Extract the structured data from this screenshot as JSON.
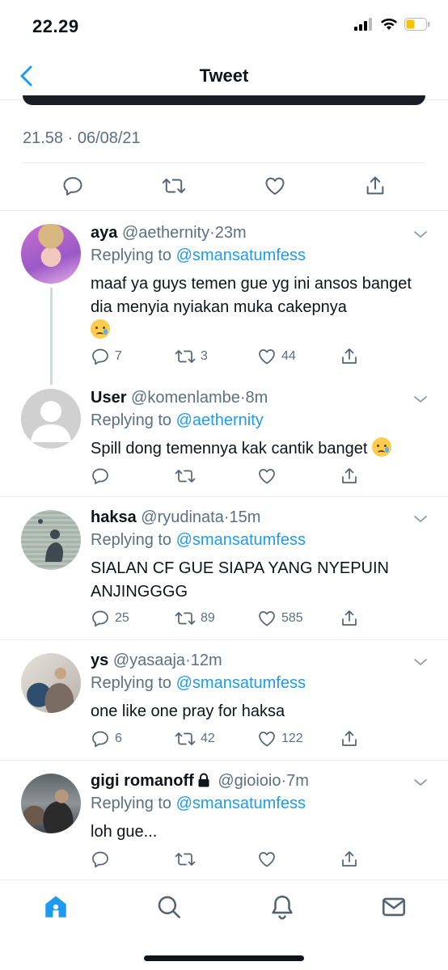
{
  "status_bar": {
    "time": "22.29"
  },
  "nav": {
    "title": "Tweet"
  },
  "tweet": {
    "timestamp": "21.58 · 06/08/21"
  },
  "replies": [
    {
      "name": "aya",
      "handle": "@aethernity",
      "time": "23m",
      "replying_label": "Replying to",
      "replying_to": "@smansatumfess",
      "text": "maaf ya guys temen gue yg ini ansos banget dia menyia nyiakan muka cakepnya",
      "emoji": "crying-face",
      "reply_count": "7",
      "retweet_count": "3",
      "like_count": "44"
    },
    {
      "name": "User",
      "handle": "@komenlambe",
      "time": "8m",
      "replying_label": "Replying to",
      "replying_to": "@aethernity",
      "text": "Spill dong temennya kak cantik banget",
      "emoji": "crying-face",
      "reply_count": "",
      "retweet_count": "",
      "like_count": ""
    },
    {
      "name": "haksa",
      "handle": "@ryudinata",
      "time": "15m",
      "replying_label": "Replying to",
      "replying_to": "@smansatumfess",
      "text": "SIALAN CF GUE SIAPA YANG NYEPUIN ANJINGGGG",
      "reply_count": "25",
      "retweet_count": "89",
      "like_count": "585"
    },
    {
      "name": "ys",
      "handle": "@yasaaja",
      "time": "12m",
      "replying_label": "Replying to",
      "replying_to": "@smansatumfess",
      "text": "one like one pray for haksa",
      "reply_count": "6",
      "retweet_count": "42",
      "like_count": "122"
    },
    {
      "name": "gigi romanoff",
      "handle": "@gioioio",
      "time": "7m",
      "replying_label": "Replying to",
      "replying_to": "@smansatumfess",
      "text": "loh gue...",
      "reply_count": "",
      "retweet_count": "",
      "like_count": ""
    }
  ],
  "colors": {
    "accent": "#1d9bf0",
    "muted": "#5b7083",
    "divider": "#e6ecf0",
    "battery": "#f5c400"
  },
  "icons": [
    "back-chevron-icon",
    "reply-icon",
    "retweet-icon",
    "like-icon",
    "share-icon",
    "chevron-down-icon",
    "lock-icon",
    "home-icon",
    "search-icon",
    "notifications-icon",
    "messages-icon"
  ]
}
